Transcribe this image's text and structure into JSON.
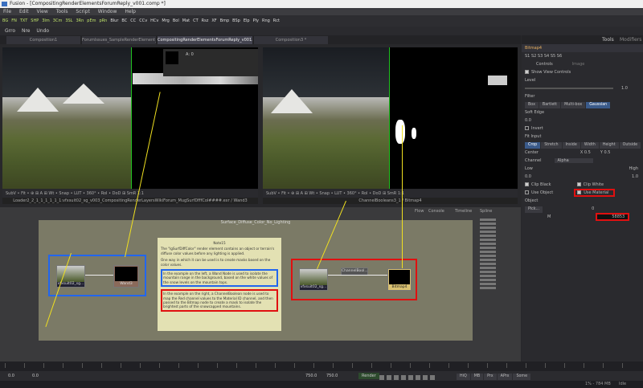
{
  "window": {
    "title": "Fusion - [CompositingRenderElementsForumReply_v001.comp *]"
  },
  "menu": [
    "File",
    "Edit",
    "View",
    "Tools",
    "Script",
    "Window",
    "Help"
  ],
  "toolbar": {
    "buttons": [
      "BG",
      "FN",
      "TXT",
      "SHP",
      "3Im",
      "3Cm",
      "3SL",
      "3Rn",
      "pEm",
      "pRn",
      "Blur",
      "BC",
      "CC",
      "CCv",
      "HCv",
      "Mrg",
      "Bol",
      "Mat",
      "CT",
      "Rsz",
      "XF",
      "Bmp",
      "BSp",
      "Elp",
      "Ply",
      "Rng",
      "Rct"
    ],
    "row2": [
      "Grro",
      "Nre",
      "Undo"
    ]
  },
  "tabs": [
    "Composition1",
    "ForumIssues_SampleRenderElement_v001.comp",
    "CompositingRenderElementsForumReply_v001.comp *",
    "Composition3 *"
  ],
  "viewer_left": {
    "overlay": "A: 0",
    "toolbar": "SubV  •  Fit  •  ⊕  ⊞  A  ⊞ Wt • Snap  •  LUT  •  360° • RoI • DoD  ⊞ SmR 1:1",
    "caption": "Loader2_2_1_1_1_1_1_1:vfxsuit02_sg_v003_CompositingRenderLayersWikiForum_MugSurfDfffCol####.exr / Wand3"
  },
  "viewer_right": {
    "toolbar": "SubV  •  Fit  •  ⊕  ⊞  A  ⊞ Wt • Snap  •  LUT  •  360° • RoI • DoD  ⊞ SmR 1:1",
    "caption": "ChannelBooleans3_1 / Bitmap4"
  },
  "flow": {
    "tabs": [
      "Flow",
      "Console",
      "Timeline",
      "Spline"
    ],
    "underlay": "Surface_Diffuse_Color_No_Lighting",
    "note": {
      "title": "Note15",
      "p1": "The \"lgSurfDiffColor\" render element contains an object or terrain's diffuse color values before any lighting is applied.",
      "p2": "One way in which it can be used is to create masks based on the color values.",
      "p3": "In the example on the left, a Wand Node is used to isolate the mountain range in the background, based on the white values of the snow levels on the mountain tops.",
      "p4": "In the example on the right, a ChannelBoolean node is used to map the Red channel values to the Material ID channel, and then passed to the Bitmap node to create a mask to isolate the brightest parts of the snowcapped mountains."
    },
    "nodes": {
      "loader_left": "vfxsuit02_sg...",
      "wand": "Wand3",
      "loader_right": "vfxsuit02_sg...",
      "channel": "ChannelBool...",
      "bitmap": "Bitmap4"
    }
  },
  "panel": {
    "tabs": [
      "Tools",
      "Modifiers"
    ],
    "node_name": "Bitmap4",
    "subs": [
      "S1",
      "S2",
      "S3",
      "S4",
      "S5",
      "S6"
    ],
    "ctabs": [
      "Controls",
      "Image"
    ],
    "show_view_controls": "Show View Controls",
    "level_label": "Level",
    "level_value": "1.0",
    "filter_label": "Filter",
    "filter": [
      "Box",
      "Bartlett",
      "Multi-box",
      "Gaussian"
    ],
    "soft_edge": "Soft Edge",
    "soft_value": "0.0",
    "invert": "Invert",
    "fit_label": "Fit Input",
    "fit": [
      "Crop",
      "Stretch",
      "Inside",
      "Width",
      "Height",
      "Outside"
    ],
    "center_label": "Center",
    "cx": "0.5",
    "cy": "0.5",
    "channel_label": "Channel",
    "channel_value": "Alpha",
    "low": "Low",
    "high": "High",
    "low_value": "0.0",
    "high_value": "1.0",
    "clip_black": "Clip Black",
    "clip_white": "Clip White",
    "use_object": "Use Object",
    "use_material": "Use Material",
    "object_label": "Object",
    "pick": "Pick...",
    "id_value": "0",
    "m_label": "M",
    "m_value": "58853"
  },
  "transport": {
    "start": "0.0",
    "end": "0.0",
    "cur1": "750.0",
    "cur2": "750.0",
    "render": "Render",
    "right": [
      "HiQ",
      "MB",
      "Prx",
      "APrx",
      "Some"
    ]
  },
  "status": {
    "mem": "1% - 784 MB",
    "state": "Idle"
  }
}
